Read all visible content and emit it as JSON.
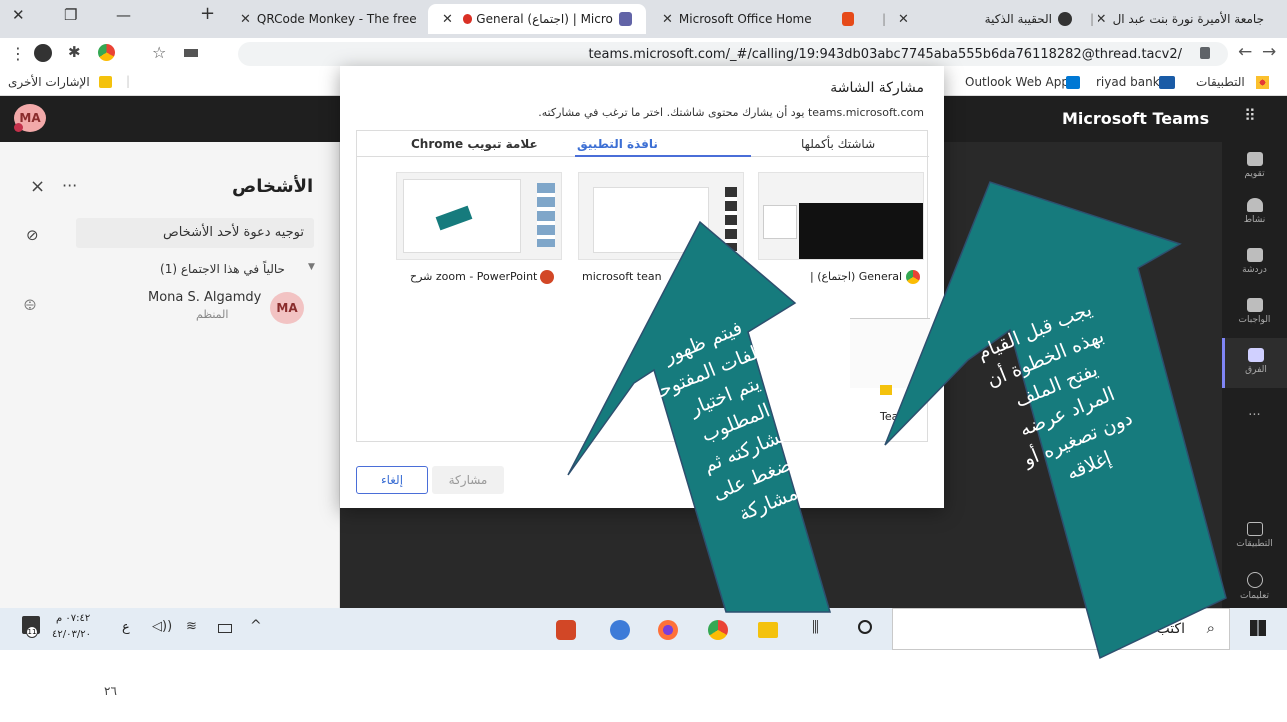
{
  "browser": {
    "tabs": [
      {
        "label": "جامعة الأميرة نورة بنت عبد ال"
      },
      {
        "label": "الحقيبة الذكية"
      },
      {
        "label": "Microsoft Office Home"
      },
      {
        "label": "General (اجتماع) | Micro"
      },
      {
        "label": "QRCode Monkey - The free"
      }
    ],
    "new_tab": "+",
    "url": "teams.microsoft.com/_#/calling/19:943db03abc7745aba555b6da76118282@thread.tacv2/",
    "bookmarks": [
      {
        "label": "التطبيقات"
      },
      {
        "label": "riyad bank"
      },
      {
        "label": "Outlook Web App"
      }
    ],
    "other_bookmarks": "الإشارات الأخرى"
  },
  "teams": {
    "title": "Microsoft Teams",
    "avatar": "MA",
    "rail": [
      {
        "label": "تقويم"
      },
      {
        "label": "نشاط"
      },
      {
        "label": "دردشة"
      },
      {
        "label": "الواجبات"
      },
      {
        "label": "الفرق"
      },
      {
        "label": "..."
      },
      {
        "label": "التطبيقات"
      },
      {
        "label": "تعليمات"
      }
    ]
  },
  "people": {
    "title": "الأشخاص",
    "more": "···",
    "close": "×",
    "invite_placeholder": "توجيه دعوة لأحد الأشخاص",
    "section": "حالياً في هذا الاجتماع (1)",
    "member": {
      "name": "Mona S. Algamdy",
      "role": "المنظم",
      "initials": "MA"
    }
  },
  "share": {
    "title": "مشاركة الشاشة",
    "subtitle": "teams.microsoft.com يود أن يشارك محتوى شاشتك. اختر ما ترغب في مشاركته.",
    "tabs": [
      {
        "label": "شاشتك بأكملها"
      },
      {
        "label": "نافذة التطبيق"
      },
      {
        "label": "علامة تبويب Chrome"
      }
    ],
    "windows": [
      {
        "label": "General (اجتماع) |"
      },
      {
        "label": "microsoft tean"
      },
      {
        "label": "zoom - PowerPoint شرح"
      }
    ],
    "peek_label": "Tea",
    "share_button": "مشاركة",
    "cancel_button": "إلغاء"
  },
  "taskbar": {
    "search_placeholder": "اكتب هنا للبحث",
    "time": "٠٧:٤٢ م",
    "date": "٤٢/٠٣/٢٠",
    "lang": "ع",
    "notify_count": "11"
  },
  "annotations": {
    "left_arrow": [
      "فيتم ظهور",
      "الملفات المفتوحة",
      "يتم اختيار",
      "المطلوب",
      "مشاركته ثم",
      "الضغط على",
      "مشاركة"
    ],
    "right_arrow": [
      "يجب قبل القيام",
      "بهذه الخطوة أن",
      "يفتح الملف",
      "المراد عرضه",
      "دون تصغيره أو",
      "إغلاقه"
    ]
  },
  "slide": {
    "page_number": "٢٦"
  },
  "colors": {
    "teams_purple": "#6264a7",
    "arrow_teal": "#167b7d",
    "dialog_accent": "#4a6ed8",
    "taskbar": "#e4ecf4"
  }
}
